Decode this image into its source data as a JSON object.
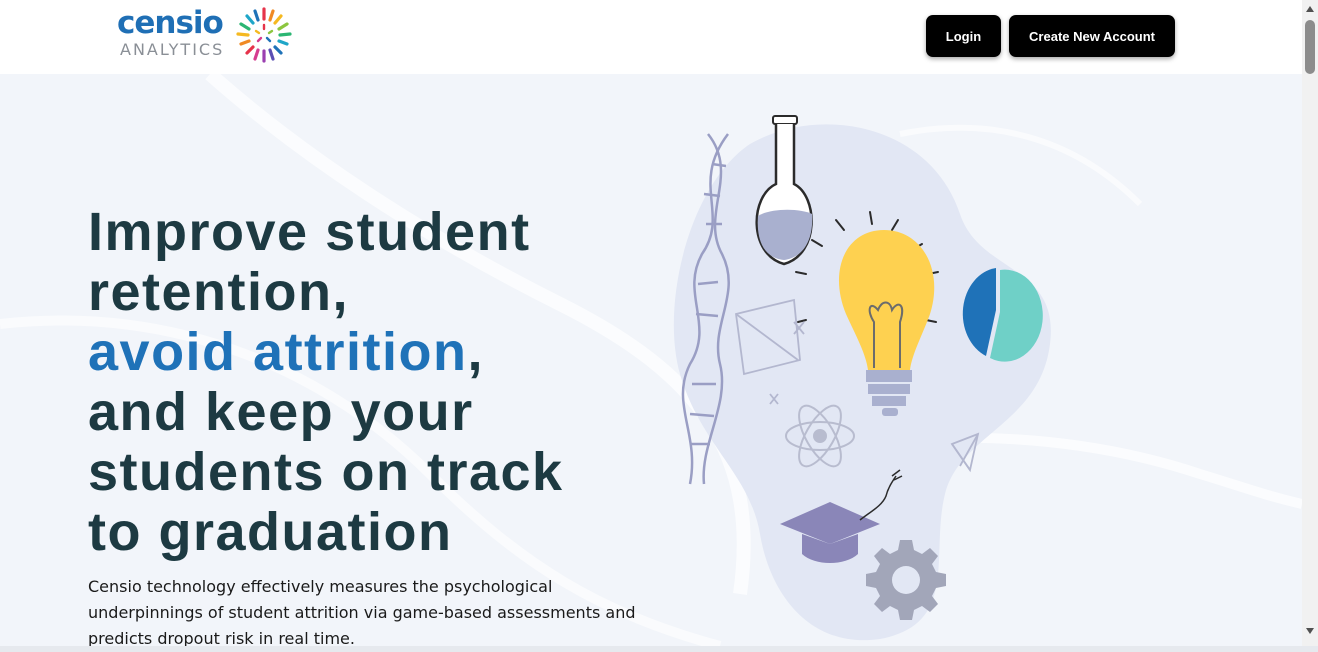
{
  "header": {
    "logo": {
      "word": "censio",
      "sub": "ANALYTICS"
    },
    "login_label": "Login",
    "create_account_label": "Create New Account"
  },
  "hero": {
    "headline_line1": "Improve student",
    "headline_line2": "retention,",
    "headline_accent": "avoid attrition",
    "headline_comma": ",",
    "headline_line4": "and keep your",
    "headline_line5": "students on track",
    "headline_line6": "to graduation",
    "description": "Censio technology effectively measures the psychological underpinnings of student attrition via game-based assessments and predicts dropout risk in real time."
  },
  "colors": {
    "accent": "#1f72b8",
    "headline": "#1d3a42",
    "button": "#000000",
    "hero_bg": "#f2f5fa"
  },
  "illustration_icons": [
    "dna-icon",
    "flask-icon",
    "lightbulb-icon",
    "pie-chart-icon",
    "atom-icon",
    "graduation-cap-icon",
    "gear-icon"
  ]
}
